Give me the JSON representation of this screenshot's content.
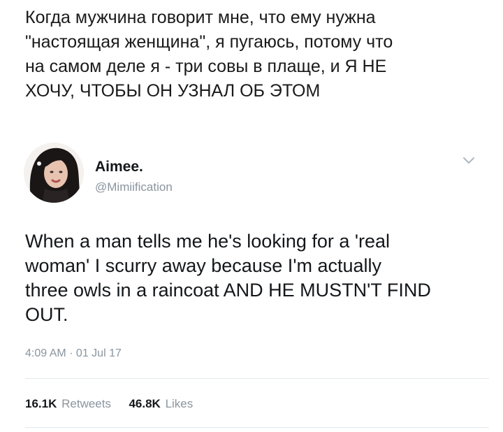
{
  "caption": "Когда мужчина говорит мне, что ему нужна\n\"настоящая женщина\", я пугаюсь, потому что\nна самом деле я - три совы в плаще, и Я НЕ\nХОЧУ, ЧТОБЫ ОН УЗНАЛ ОБ ЭТОМ",
  "tweet": {
    "author_name": "Aimee.",
    "author_handle": "@Mimiification",
    "text": "When a man tells me he's looking for a 'real\nwoman' I scurry away because I'm actually\nthree owls in a raincoat AND HE MUSTN'T FIND\nOUT.",
    "timestamp": "4:09 AM · 01 Jul 17",
    "retweets_count": "16.1K",
    "retweets_label": "Retweets",
    "likes_count": "46.8K",
    "likes_label": "Likes",
    "menu_icon": "chevron-down-icon",
    "avatar_icon": "profile-photo"
  },
  "colors": {
    "text": "#14171a",
    "secondary": "#8a959e",
    "divider": "#e1e8ed"
  }
}
